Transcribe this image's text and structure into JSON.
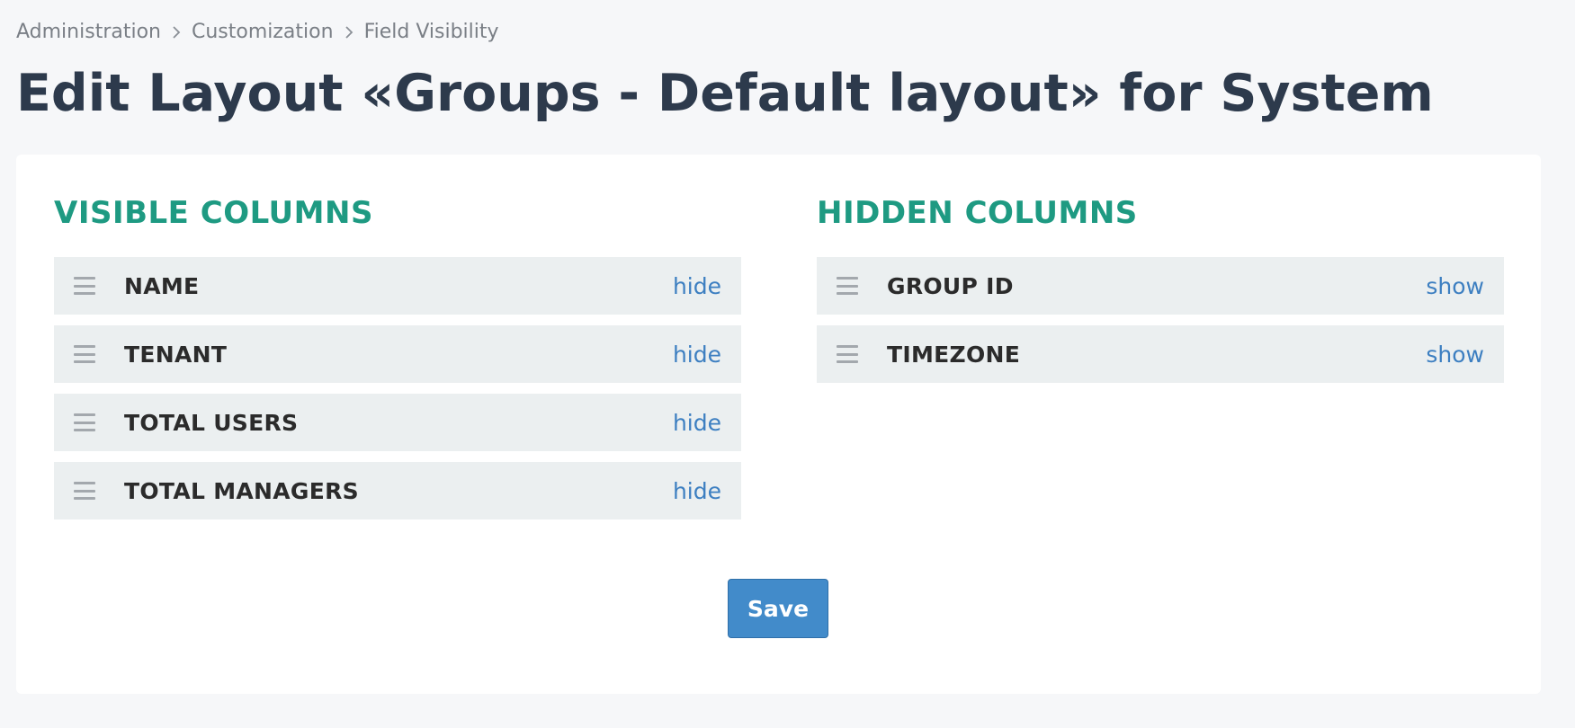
{
  "breadcrumb": {
    "items": [
      "Administration",
      "Customization",
      "Field Visibility"
    ]
  },
  "page": {
    "title": "Edit Layout «Groups - Default layout» for System"
  },
  "visible_columns": {
    "heading": "VISIBLE COLUMNS",
    "action_label": "hide",
    "items": [
      "NAME",
      "TENANT",
      "TOTAL USERS",
      "TOTAL MANAGERS"
    ]
  },
  "hidden_columns": {
    "heading": "HIDDEN COLUMNS",
    "action_label": "show",
    "items": [
      "GROUP ID",
      "TIMEZONE"
    ]
  },
  "actions": {
    "save_label": "Save"
  },
  "colors": {
    "page_background": "#f6f7f9",
    "heading_accent": "#1e9a82",
    "link": "#3d7fc1",
    "primary_button": "#428bca",
    "row_background": "#ebeff0"
  },
  "icons": {
    "breadcrumb_separator": "chevron-right-icon",
    "row_handle": "drag-handle-icon"
  }
}
